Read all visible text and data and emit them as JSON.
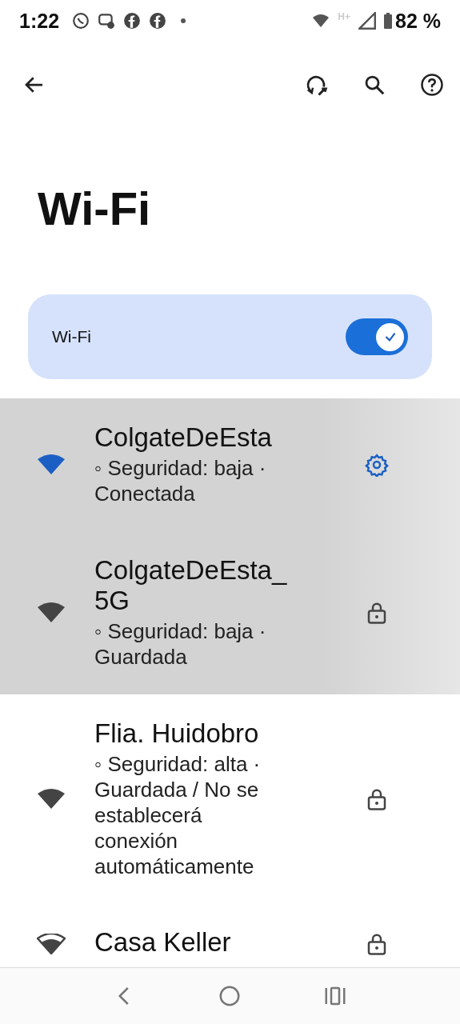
{
  "status_bar": {
    "time": "1:22",
    "battery": "82 %",
    "network": "H+"
  },
  "toolbar": {
    "actions": [
      {
        "kind": "repair"
      },
      {
        "kind": "search"
      },
      {
        "kind": "help"
      }
    ]
  },
  "title": "Wi-Fi",
  "wifi_toggle": {
    "label": "Wi-Fi",
    "on": true
  },
  "networks": [
    {
      "name": "ColgateDeEsta",
      "status": "◦ Seguridad: baja · Conectada",
      "connected": true,
      "highlighted": true,
      "signal_full": true,
      "kind": "settings"
    },
    {
      "name": "ColgateDeEsta_5G",
      "status": "◦ Seguridad: baja · Guardada",
      "connected": false,
      "highlighted": true,
      "signal_full": true,
      "kind": "lock"
    },
    {
      "name": "Flia. Huidobro",
      "status": "◦ Seguridad: alta · Guardada / No se establecerá conexión automáticamente",
      "connected": false,
      "highlighted": false,
      "signal_full": true,
      "kind": "lock"
    },
    {
      "name": "Casa Keller",
      "connected": false,
      "highlighted": false,
      "signal_full": false,
      "kind": "lock"
    }
  ]
}
